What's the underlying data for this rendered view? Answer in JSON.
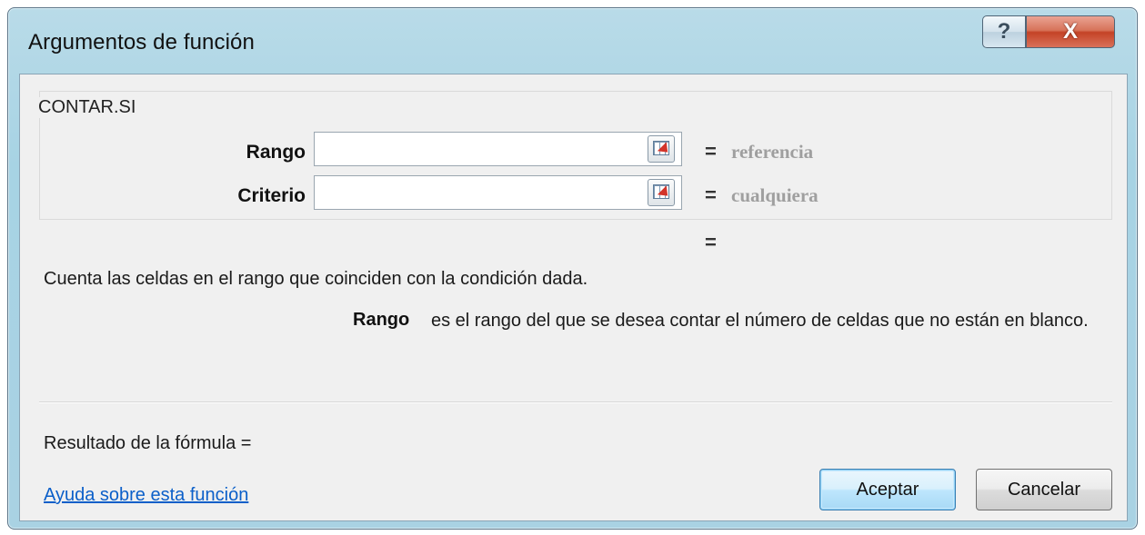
{
  "window": {
    "title": "Argumentos de función",
    "help_glyph": "?",
    "close_glyph": "X"
  },
  "function_group": {
    "name": "CONTAR.SI",
    "args": [
      {
        "label": "Rango",
        "value": "",
        "equals": "=",
        "result": "referencia"
      },
      {
        "label": "Criterio",
        "value": "",
        "equals": "=",
        "result": "cualquiera"
      }
    ],
    "overall_equals": "="
  },
  "description": "Cuenta las celdas en el rango que coinciden con la condición dada.",
  "param_help": {
    "name": "Rango",
    "text": "es el rango del que se desea contar el número de celdas que no están en blanco."
  },
  "formula_result": {
    "label": "Resultado de la fórmula ="
  },
  "footer": {
    "help_link": "Ayuda sobre esta función",
    "ok_label": "Aceptar",
    "cancel_label": "Cancelar"
  },
  "icons": {
    "ref_button": "collapse-dialog-icon",
    "help": "help-icon",
    "close": "close-icon"
  },
  "colors": {
    "title_bar": "#a9d2e3",
    "close_button": "#c44326",
    "link": "#0b5fc9",
    "arg_result_text": "#9f9f9f"
  }
}
